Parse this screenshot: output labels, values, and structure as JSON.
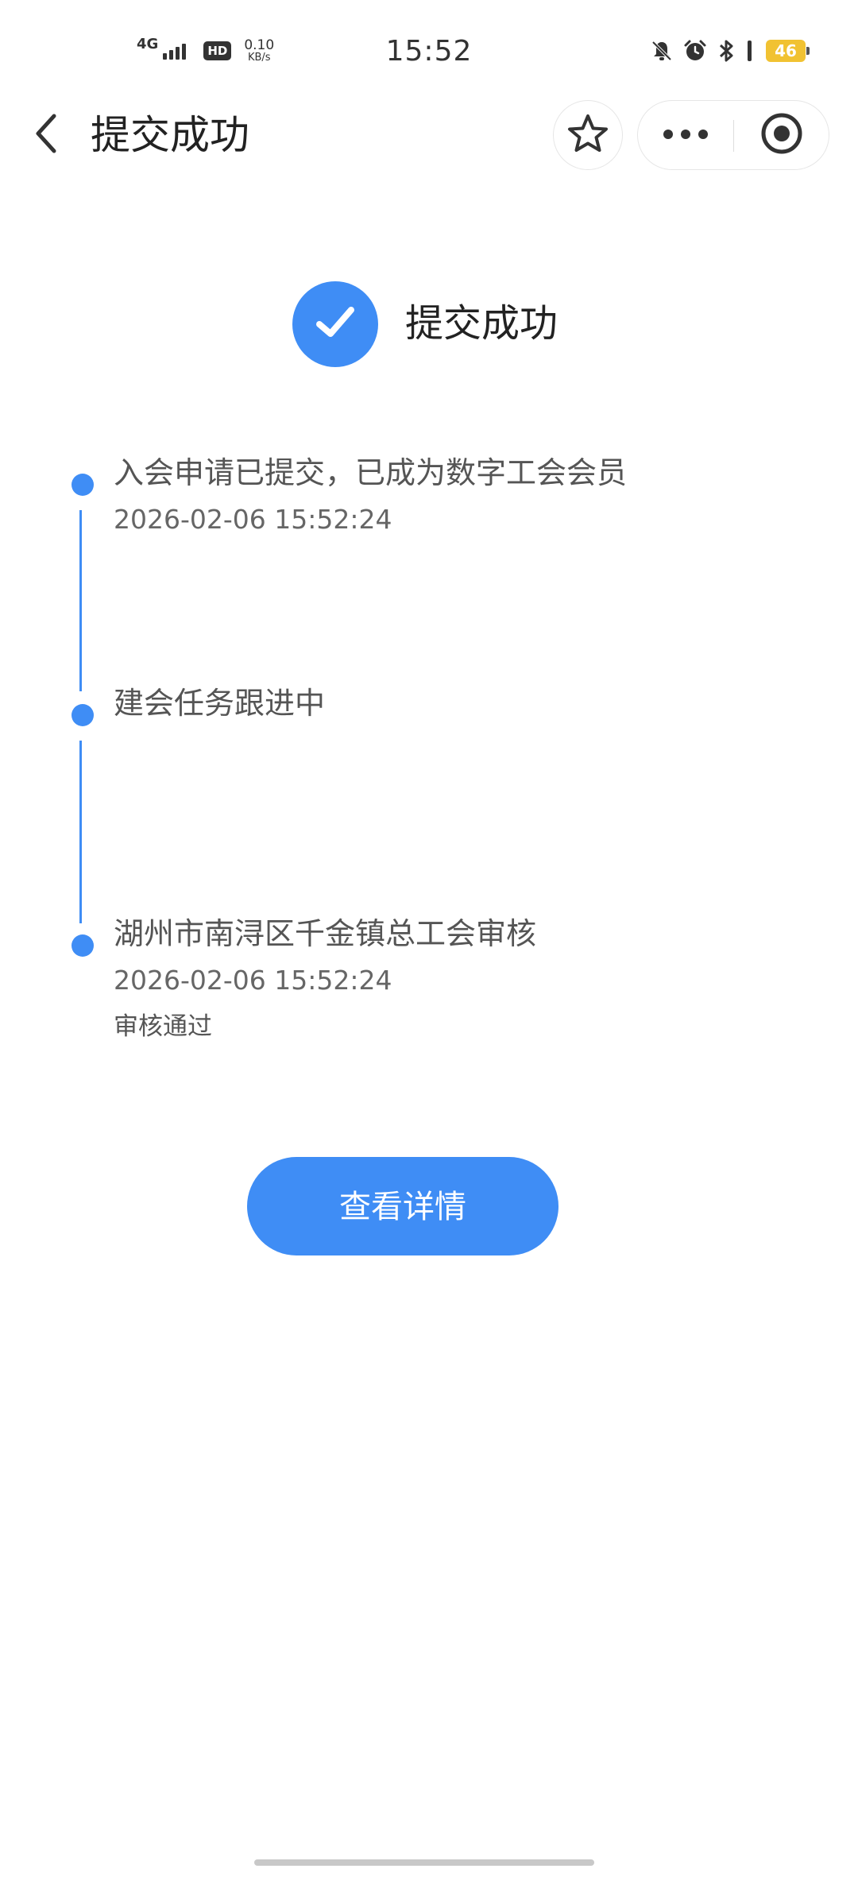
{
  "status_bar": {
    "network_type": "4G",
    "hd_badge": "HD",
    "net_speed_value": "0.10",
    "net_speed_unit": "KB/s",
    "time": "15:52",
    "battery_level": "46",
    "battery_color": "#f1c232",
    "icons": [
      "signal-icon",
      "mute-bell-icon",
      "alarm-icon",
      "bluetooth-icon",
      "battery-icon"
    ]
  },
  "nav": {
    "title": "提交成功",
    "icons": [
      "back-arrow-icon",
      "star-icon",
      "more-dots-icon",
      "close-circle-icon"
    ]
  },
  "success": {
    "title": "提交成功",
    "icon": "checkmark-icon"
  },
  "timeline": {
    "items": [
      {
        "title": "入会申请已提交，已成为数字工会会员",
        "time": "2026-02-06 15:52:24"
      },
      {
        "title": "建会任务跟进中"
      },
      {
        "title": "湖州市南浔区千金镇总工会审核",
        "time": "2026-02-06 15:52:24",
        "note": "审核通过"
      }
    ]
  },
  "actions": {
    "detail_label": "查看详情"
  },
  "colors": {
    "accent": "#3f8df5",
    "text_primary": "#222222",
    "text_secondary": "#555555"
  }
}
